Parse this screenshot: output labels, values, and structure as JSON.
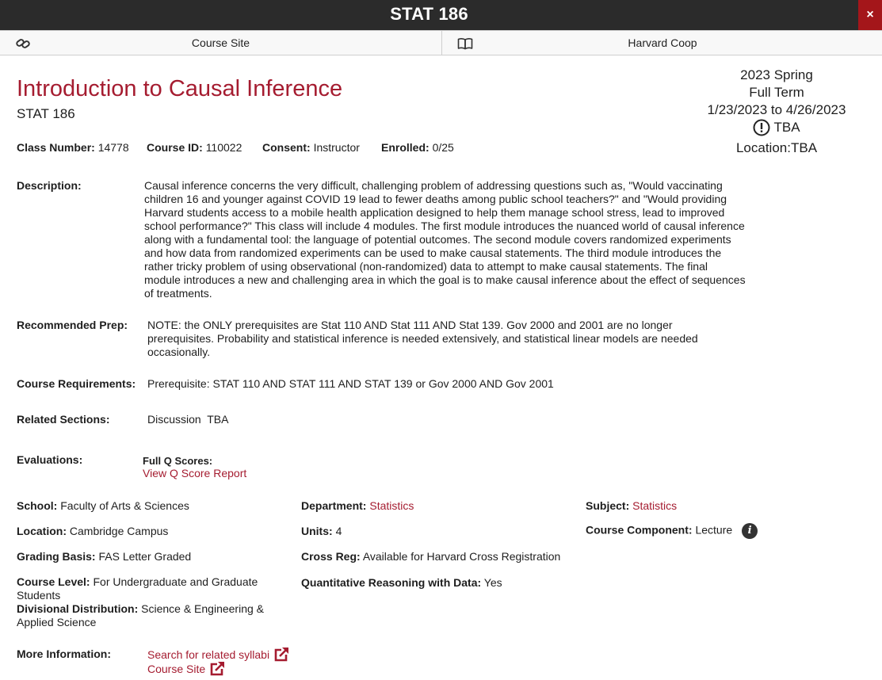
{
  "window": {
    "title": "STAT 186",
    "close_label": "×"
  },
  "linkbar": {
    "course_site": {
      "label": "Course Site",
      "icon": "link-icon"
    },
    "coop": {
      "label": "Harvard Coop",
      "icon": "book-icon"
    }
  },
  "course": {
    "title": "Introduction to Causal Inference",
    "code": "STAT 186"
  },
  "term": {
    "semester": "2023 Spring",
    "session": "Full Term",
    "dates": "1/23/2023 to 4/26/2023",
    "meeting": "TBA",
    "location": "Location:TBA"
  },
  "meta": {
    "class_number_label": "Class Number:",
    "class_number": "14778",
    "course_id_label": "Course ID:",
    "course_id": "110022",
    "consent_label": "Consent:",
    "consent": "Instructor",
    "enrolled_label": "Enrolled:",
    "enrolled": "0/25"
  },
  "description": {
    "label": "Description:",
    "text": "Causal inference concerns the very difficult, challenging problem of addressing questions such as, \"Would vaccinating children 16 and younger against COVID 19 lead to fewer deaths among public school teachers?\" and \"Would providing Harvard students access to a mobile health application designed to help them manage school stress, lead to improved school performance?\"  This class will include 4 modules.  The first module introduces the nuanced world of causal inference along with a fundamental tool: the language of potential outcomes.  The second module covers randomized experiments and how data from randomized experiments can be used to make causal statements.  The third module introduces the rather tricky problem of using observational (non-randomized) data to attempt to make causal statements.  The final module introduces a new and challenging area in which the goal is to make causal inference about the effect of sequences of treatments."
  },
  "prep": {
    "label": "Recommended Prep:",
    "text": "NOTE: the ONLY prerequisites are Stat 110 AND Stat 111 AND Stat 139. Gov 2000 and 2001 are no longer prerequisites. Probability and statistical inference is needed extensively, and statistical linear models are needed occasionally."
  },
  "requirements": {
    "label": "Course Requirements:",
    "text": "Prerequisite: STAT 110 AND STAT 111 AND STAT 139 or Gov 2000 AND Gov 2001"
  },
  "sections": {
    "label": "Related Sections:",
    "text": "Discussion  TBA"
  },
  "evaluations": {
    "label": "Evaluations:",
    "subheading": "Full Q Scores:",
    "link": "View Q Score Report"
  },
  "details": {
    "school_label": "School:",
    "school": "Faculty of Arts & Sciences",
    "department_label": "Department:",
    "department": "Statistics",
    "subject_label": "Subject:",
    "subject": "Statistics",
    "location_label": "Location:",
    "location": "Cambridge Campus",
    "units_label": "Units:",
    "units": "4",
    "component_label": "Course Component:",
    "component": "Lecture",
    "grading_label": "Grading Basis:",
    "grading": "FAS Letter Graded",
    "crossreg_label": "Cross Reg:",
    "crossreg": "Available for Harvard Cross Registration",
    "level_label": "Course Level:",
    "level": "For Undergraduate and Graduate Students",
    "qrd_label": "Quantitative Reasoning with Data:",
    "qrd": "Yes",
    "divisional_label": "Divisional Distribution:",
    "divisional": "Science & Engineering & Applied Science"
  },
  "more_info": {
    "label": "More Information:",
    "syllabi_link": "Search for related syllabi",
    "course_site_link": "Course Site"
  },
  "colors": {
    "accent": "#a51c30",
    "header_bg": "#2b2b2b",
    "close_bg": "#a4161a"
  }
}
